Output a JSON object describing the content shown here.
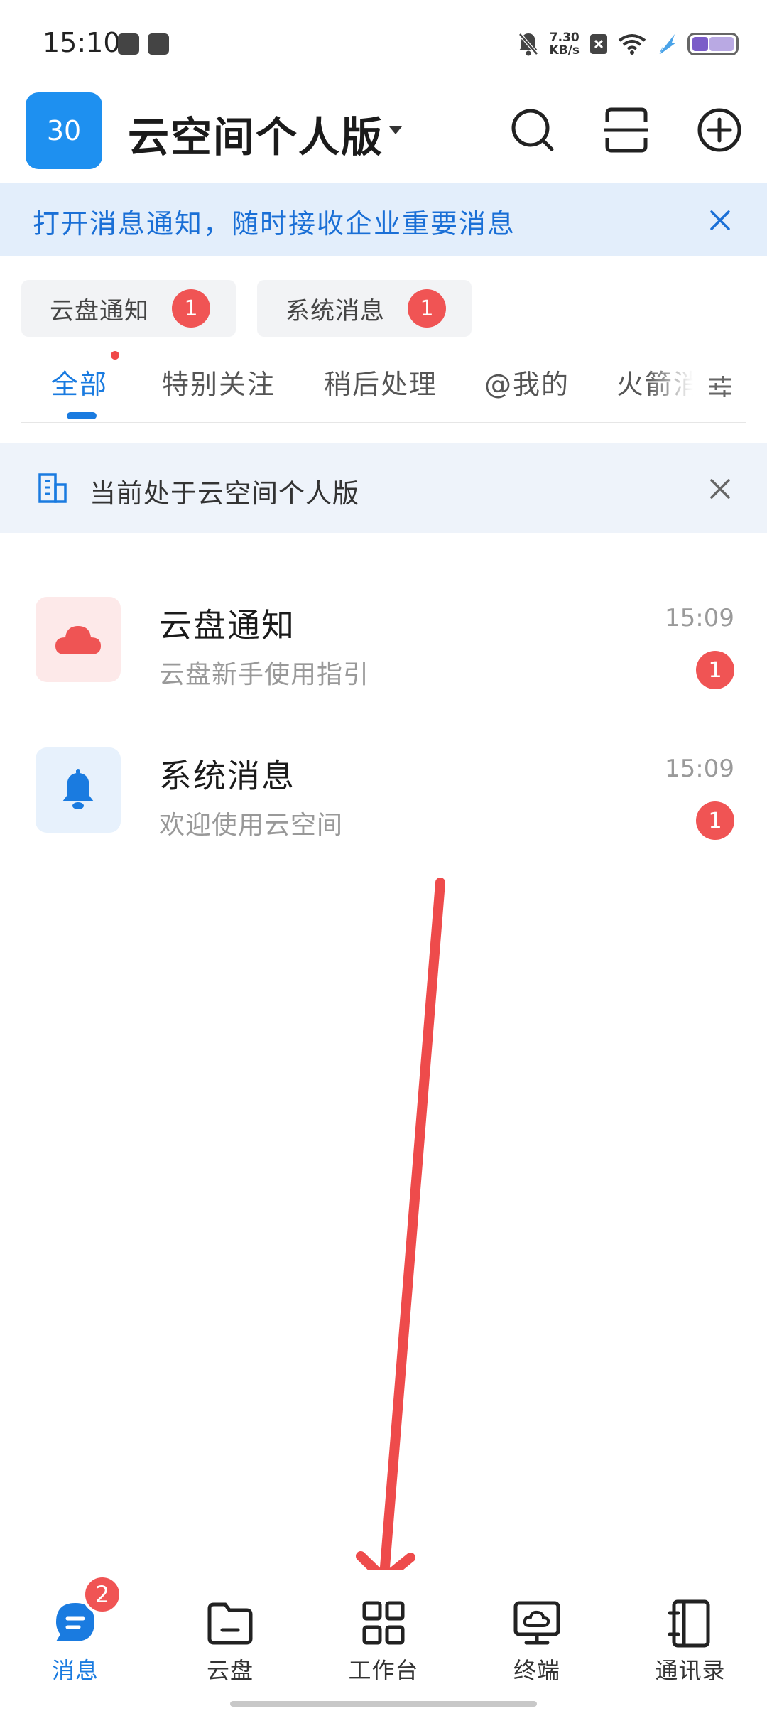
{
  "status_bar": {
    "time": "15:10",
    "net_speed_value": "7.30",
    "net_speed_unit": "KB/s"
  },
  "header": {
    "logo_text": "30",
    "title": "云空间个人版",
    "icons": [
      "search-icon",
      "scan-icon",
      "add-icon"
    ]
  },
  "notify_banner": {
    "text": "打开消息通知，随时接收企业重要消息"
  },
  "chips": [
    {
      "label": "云盘通知",
      "badge": "1"
    },
    {
      "label": "系统消息",
      "badge": "1"
    }
  ],
  "tabs": [
    {
      "label": "全部",
      "active": true
    },
    {
      "label": "特别关注"
    },
    {
      "label": "稍后处理"
    },
    {
      "label": "@我的"
    },
    {
      "label": "火箭消"
    }
  ],
  "edition_banner": {
    "text": "当前处于云空间个人版"
  },
  "messages": [
    {
      "title": "云盘通知",
      "subtitle": "云盘新手使用指引",
      "time": "15:09",
      "badge": "1",
      "icon": "cloud-icon"
    },
    {
      "title": "系统消息",
      "subtitle": "欢迎使用云空间",
      "time": "15:09",
      "badge": "1",
      "icon": "bell-icon"
    }
  ],
  "bottom_nav": [
    {
      "label": "消息",
      "icon": "message-icon",
      "badge": "2",
      "active": true
    },
    {
      "label": "云盘",
      "icon": "folder-icon"
    },
    {
      "label": "工作台",
      "icon": "grid-icon"
    },
    {
      "label": "终端",
      "icon": "terminal-icon"
    },
    {
      "label": "通讯录",
      "icon": "contacts-icon"
    }
  ],
  "colors": {
    "accent": "#1a7be0",
    "badge": "#f05454",
    "banner_bg": "#e3eefb",
    "annotation_arrow": "#ee4b4b"
  }
}
